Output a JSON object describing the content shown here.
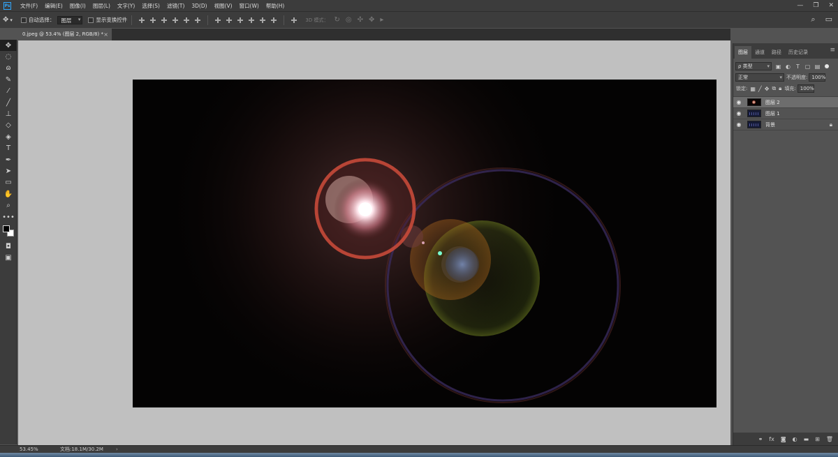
{
  "menubar": {
    "app_badge": "Ps",
    "items": [
      "文件(F)",
      "编辑(E)",
      "图像(I)",
      "图层(L)",
      "文字(Y)",
      "选择(S)",
      "滤镜(T)",
      "3D(D)",
      "视图(V)",
      "窗口(W)",
      "帮助(H)"
    ],
    "window_controls": {
      "minimize": "—",
      "restore": "❐",
      "close": "✕"
    }
  },
  "options_bar": {
    "auto_select_label": "自动选择：",
    "auto_select_value": "图层",
    "show_transform_label": "显示变换控件",
    "mode_3d_label": "3D 模式："
  },
  "document": {
    "tab_title": "0.jpeg @ 53.4% (图层 2, RGB/8) *",
    "close_glyph": "×"
  },
  "status": {
    "zoom": "53.45%",
    "doc_size": "文档:18.1M/30.2M",
    "arrow": "›"
  },
  "panels": {
    "tabs": [
      "图层",
      "通道",
      "路径",
      "历史记录"
    ],
    "active_tab": 0,
    "filter_kind": "ρ 类型",
    "blend_mode": "正常",
    "opacity_label": "不透明度:",
    "opacity_value": "100%",
    "lock_label": "锁定:",
    "fill_label": "填充:",
    "fill_value": "100%"
  },
  "layers": [
    {
      "name": "图层 2",
      "selected": true,
      "locked": false,
      "thumb": "flare"
    },
    {
      "name": "图层 1",
      "selected": false,
      "locked": false,
      "thumb": "stars"
    },
    {
      "name": "背景",
      "selected": false,
      "locked": true,
      "thumb": "stars"
    }
  ],
  "colors": {
    "chrome": "#3c3c3c",
    "panel": "#535353",
    "canvas_backdrop": "#c0c0c0",
    "accent": "#31a8ff",
    "foreground_swatch": "#000000",
    "background_swatch": "#ffffff"
  }
}
